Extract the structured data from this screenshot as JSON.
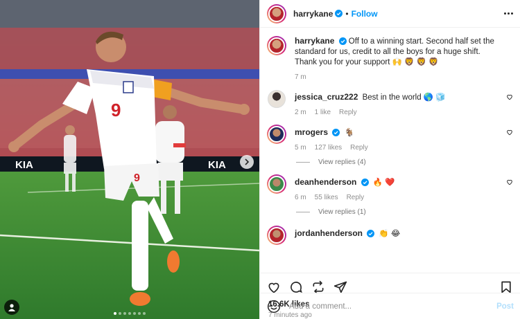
{
  "photo": {
    "carousel_total": 7,
    "carousel_active": 1,
    "board_left": "KIA",
    "board_right": "KIA"
  },
  "header": {
    "username": "harrykane",
    "follow_label": "Follow",
    "separator": "•"
  },
  "caption": {
    "username": "harrykane",
    "text": "Off to a winning start. Second half set the standard for us, credit to all the boys for a huge shift. Thank you for your support 🙌 🦁 🦁 🦁",
    "time": "7 m"
  },
  "comments": [
    {
      "username": "jessica_cruz222",
      "text": "Best in the world 🌎 🧊",
      "time": "2 m",
      "likes": "1 like",
      "reply_label": "Reply",
      "verified": false
    },
    {
      "username": "mrogers",
      "text": "🐐",
      "time": "5 m",
      "likes": "127 likes",
      "reply_label": "Reply",
      "verified": true,
      "view_replies": "View replies (4)"
    },
    {
      "username": "deanhenderson",
      "text": "🔥 ❤️",
      "time": "6 m",
      "likes": "55 likes",
      "reply_label": "Reply",
      "verified": true,
      "view_replies": "View replies (1)"
    },
    {
      "username": "jordanhenderson",
      "text": "👏 😂",
      "verified": true
    }
  ],
  "stats": {
    "likes": "16.6K likes",
    "posted": "7 minutes ago"
  },
  "composer": {
    "placeholder": "Add a comment...",
    "post_label": "Post"
  },
  "colors": {
    "accent": "#0095f6",
    "post_disabled": "#b2dffc",
    "muted": "#8e8e8e"
  }
}
